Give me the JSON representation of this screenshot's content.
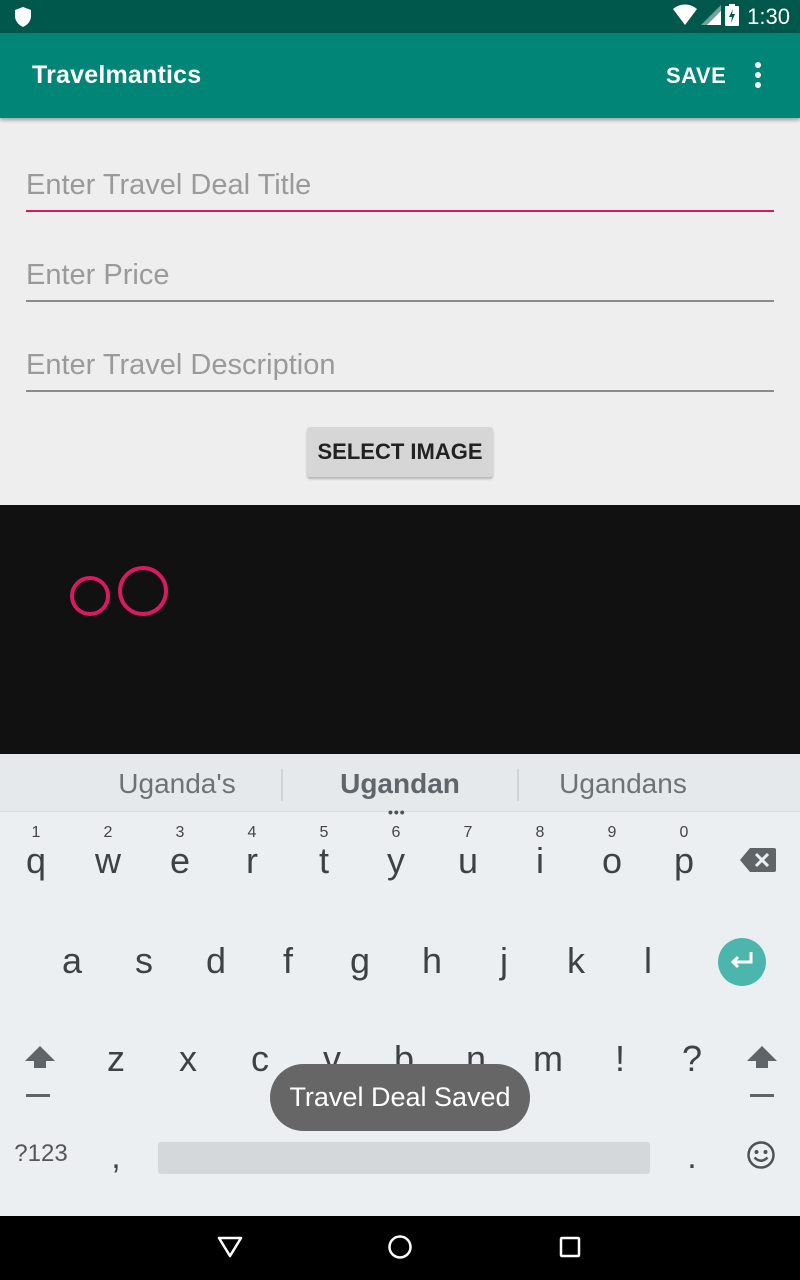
{
  "status_bar": {
    "time": "1:30",
    "icons": [
      "shield-icon",
      "wifi-icon",
      "signal-icon",
      "battery-icon"
    ]
  },
  "app_bar": {
    "title": "Travelmantics",
    "save_label": "SAVE",
    "menu_icon": "more-vert-icon"
  },
  "form": {
    "title_placeholder": "Enter Travel Deal Title",
    "price_placeholder": "Enter Price",
    "description_placeholder": "Enter Travel Description",
    "select_image_label": "SELECT IMAGE"
  },
  "colors": {
    "primary": "#008577",
    "primary_dark": "#00574b",
    "accent": "#d81b60",
    "enter": "#4db6ac"
  },
  "keyboard": {
    "suggestions": [
      "Uganda's",
      "Ugandan",
      "Ugandans"
    ],
    "row1_hints": [
      "1",
      "2",
      "3",
      "4",
      "5",
      "6",
      "7",
      "8",
      "9",
      "0"
    ],
    "row1": [
      "q",
      "w",
      "e",
      "r",
      "t",
      "y",
      "u",
      "i",
      "o",
      "p"
    ],
    "row2": [
      "a",
      "s",
      "d",
      "f",
      "g",
      "h",
      "j",
      "k",
      "l"
    ],
    "row3": [
      "z",
      "x",
      "c",
      "v",
      "b",
      "n",
      "m",
      "!",
      "?"
    ],
    "symbols_label": "?123",
    "comma": ",",
    "period": "."
  },
  "toast": {
    "message": "Travel Deal Saved"
  }
}
